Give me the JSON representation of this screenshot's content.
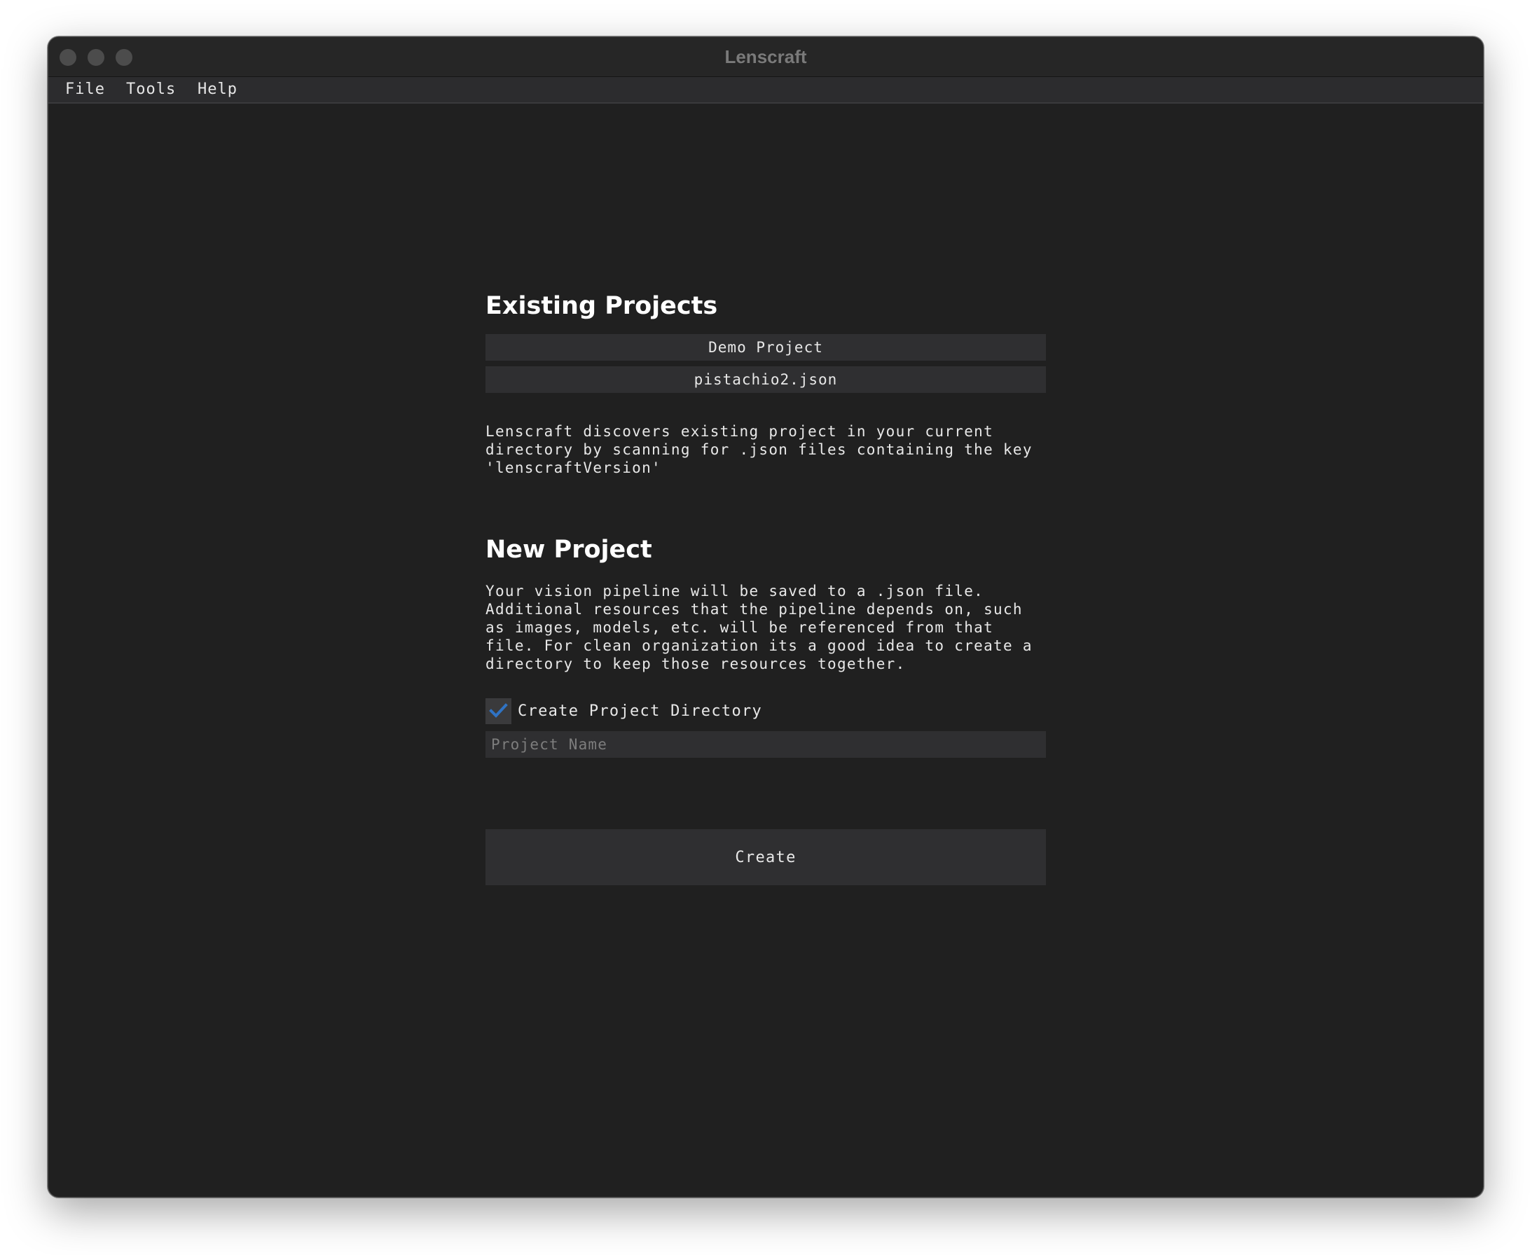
{
  "window": {
    "title": "Lenscraft"
  },
  "menubar": {
    "items": [
      {
        "label": "File"
      },
      {
        "label": "Tools"
      },
      {
        "label": "Help"
      }
    ]
  },
  "existing_projects": {
    "heading": "Existing Projects",
    "projects": [
      {
        "label": "Demo Project"
      },
      {
        "label": "pistachio2.json"
      }
    ],
    "description": "Lenscraft discovers existing project in your current\ndirectory by scanning for .json files containing the key\n'lenscraftVersion'"
  },
  "new_project": {
    "heading": "New Project",
    "description": "Your vision pipeline will be saved to a .json file.\nAdditional resources that the pipeline depends on, such\nas images, models, etc. will be referenced from that\nfile. For clean organization its a good idea to create a\ndirectory to keep those resources together.",
    "create_directory": {
      "label": "Create Project Directory",
      "checked": true,
      "check_color": "#2f73c4"
    },
    "name_input": {
      "placeholder": "Project Name",
      "value": ""
    },
    "create_label": "Create"
  }
}
